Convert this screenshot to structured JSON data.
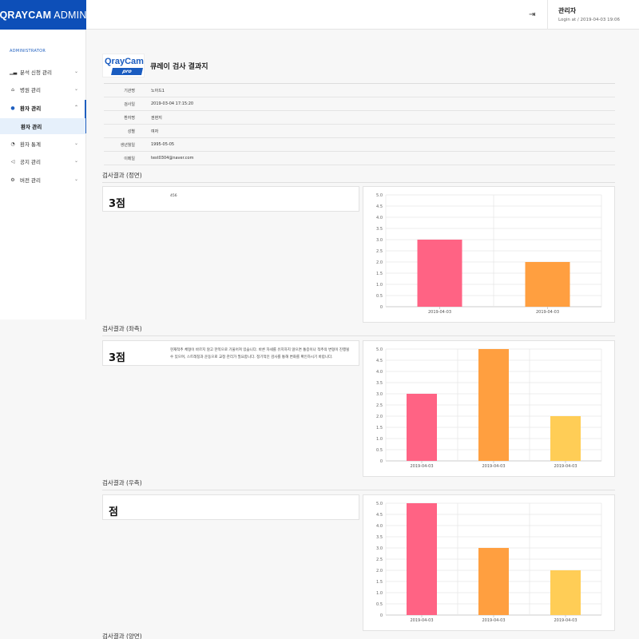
{
  "app": {
    "brand_bold": "QRAYCAM",
    "brand_rest": "ADMIN"
  },
  "header": {
    "user_name": "관리자",
    "login_text": "Login at / 2019-04-03 19:06",
    "logout_icon": "sign-out-icon"
  },
  "sidebar": {
    "heading": "ADMINISTRATOR",
    "items": [
      {
        "label": "분석 신청 관리",
        "icon": "bar-chart-icon"
      },
      {
        "label": "병원 관리",
        "icon": "hospital-icon"
      },
      {
        "label": "환자 관리",
        "icon": "user-icon"
      },
      {
        "label": "환자 통계",
        "icon": "pie-chart-icon"
      },
      {
        "label": "공지 관리",
        "icon": "megaphone-icon"
      },
      {
        "label": "버전 관리",
        "icon": "cogs-icon"
      }
    ],
    "active_sub": "환자 관리"
  },
  "report": {
    "logo_text": "QrayCam",
    "logo_badge": "pro",
    "title": "큐레이 검사 결과지",
    "info": [
      {
        "key": "기관명",
        "value": "노아드1"
      },
      {
        "key": "검사일",
        "value": "2019-03-04 17:15:20"
      },
      {
        "key": "환자명",
        "value": "권현지"
      },
      {
        "key": "성별",
        "value": "여자"
      },
      {
        "key": "생년월일",
        "value": "1995-05-05"
      },
      {
        "key": "이메일",
        "value": "test0304@naver.com"
      }
    ]
  },
  "sections": [
    {
      "title": "검사결과 (정면)",
      "score": "3점",
      "comment": "456"
    },
    {
      "title": "검사결과 (좌측)",
      "score": "3점",
      "comment": "현재척추 체형이 바르지 않고 한쪽으로 기울어져 있습니다. 바른 자세를 유지하지 않으면 통증이나 척추의 변형이 진행될 수 있으며, 스트레칭과 운동으로 교정 관리가 필요합니다. 정기적인 검사를 통해 변화를 확인하시기 바랍니다."
    },
    {
      "title": "검사결과 (우측)",
      "score": "점",
      "comment": ""
    },
    {
      "title": "검사결과 (양면)"
    }
  ],
  "colors": [
    "#ff6384",
    "#ff9f40",
    "#ffcd56"
  ],
  "chart_data": [
    {
      "type": "bar",
      "categories": [
        "2019-04-03",
        "2019-04-03"
      ],
      "values": [
        3,
        2
      ],
      "ylim": [
        0,
        5
      ],
      "yticks": [
        "0",
        "0.5",
        "1.0",
        "1.5",
        "2.0",
        "2.5",
        "3.0",
        "3.5",
        "4.0",
        "4.5",
        "5.0"
      ],
      "grid": true
    },
    {
      "type": "bar",
      "categories": [
        "2019-04-03",
        "2019-04-03",
        "2019-04-03"
      ],
      "values": [
        3,
        5,
        2
      ],
      "ylim": [
        0,
        5
      ],
      "yticks": [
        "0",
        "0.5",
        "1.0",
        "1.5",
        "2.0",
        "2.5",
        "3.0",
        "3.5",
        "4.0",
        "4.5",
        "5.0"
      ],
      "grid": true
    },
    {
      "type": "bar",
      "categories": [
        "2019-04-03",
        "2019-04-03",
        "2019-04-03"
      ],
      "values": [
        5,
        3,
        2
      ],
      "ylim": [
        0,
        5
      ],
      "yticks": [
        "0",
        "0.5",
        "1.0",
        "1.5",
        "2.0",
        "2.5",
        "3.0",
        "3.5",
        "4.0",
        "4.5",
        "5.0"
      ],
      "grid": true
    }
  ]
}
